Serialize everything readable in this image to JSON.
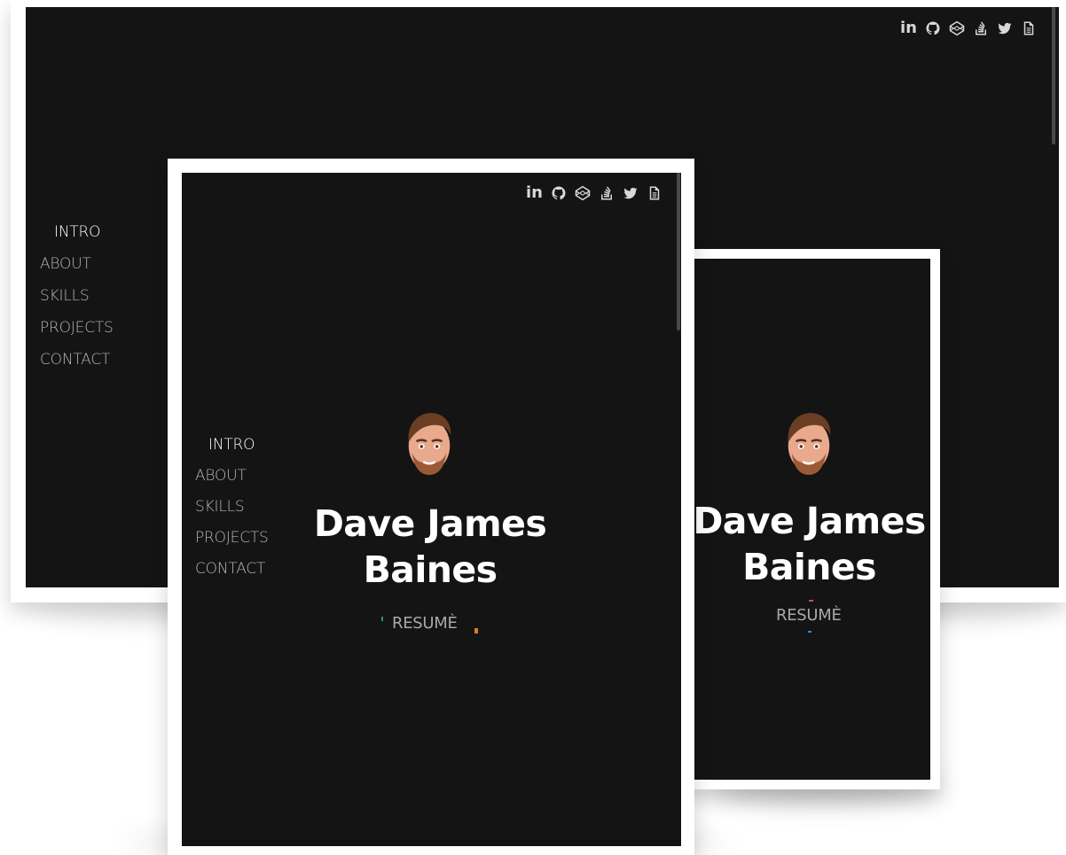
{
  "colors": {
    "screen_bg": "#141414",
    "frame": "#ffffff",
    "nav_text": "#b4b4b4",
    "nav_active": "#ffffff",
    "icon": "#d8d8d8",
    "accent_green": "#22a06b",
    "accent_orange": "#d9792b",
    "accent_red": "#d84a4a",
    "accent_blue": "#2f8de0"
  },
  "profile": {
    "first_line": "Dave James",
    "second_line": "Baines",
    "resume_label": "RESUMÈ",
    "avatar_icon": "memoji-avatar-icon"
  },
  "nav": {
    "items": [
      {
        "label": "INTRO",
        "active": true
      },
      {
        "label": "ABOUT",
        "active": false
      },
      {
        "label": "SKILLS",
        "active": false
      },
      {
        "label": "PROJECTS",
        "active": false
      },
      {
        "label": "CONTACT",
        "active": false
      }
    ]
  },
  "social": {
    "icons": [
      "linkedin-icon",
      "github-icon",
      "codepen-icon",
      "stackoverflow-icon",
      "twitter-icon",
      "document-icon"
    ],
    "linkedin_text": "in"
  }
}
